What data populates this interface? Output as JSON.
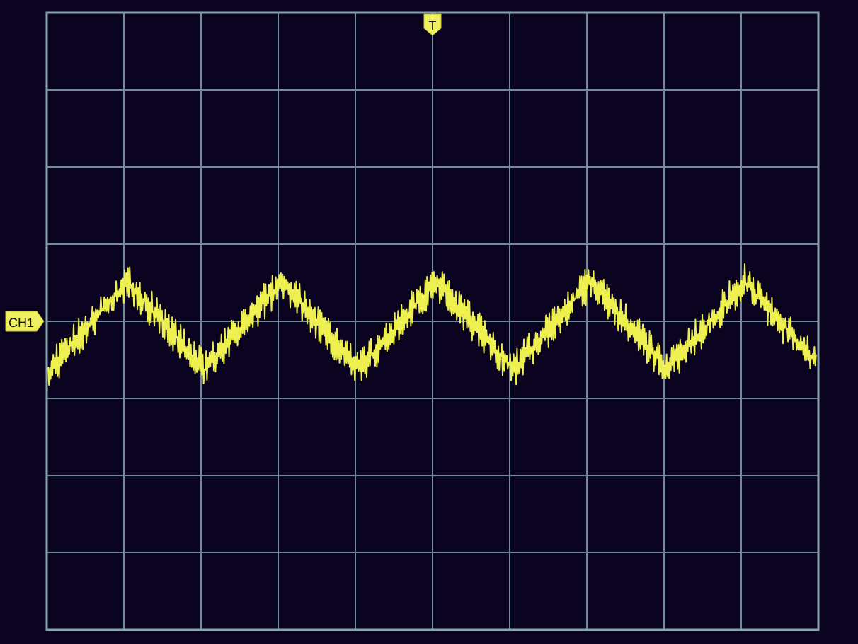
{
  "trigger_marker": {
    "label": "T"
  },
  "channel_marker": {
    "label": "CH1"
  }
}
